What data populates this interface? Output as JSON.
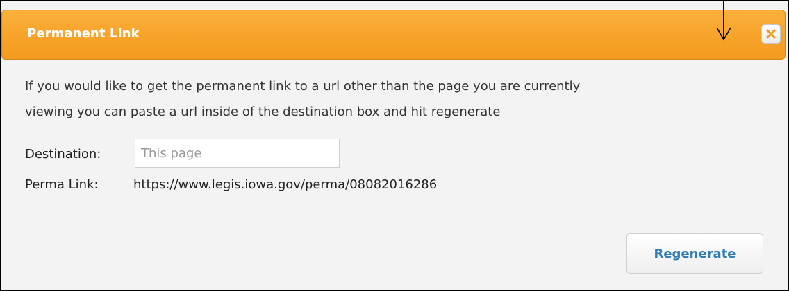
{
  "dialog": {
    "title": "Permanent Link",
    "close_icon": "close-icon",
    "description_line1": "If you would like to get the permanent link to a url other than the page you are currently",
    "description_line2": "viewing you can paste a url inside of the destination box and hit regenerate",
    "destination_label": "Destination:",
    "destination_placeholder": "This page",
    "destination_value": "",
    "perma_label": "Perma Link:",
    "perma_value": "https://www.legis.iowa.gov/perma/08082016286",
    "regenerate_label": "Regenerate"
  },
  "colors": {
    "header": "#f7a329",
    "header_border": "#d08a14",
    "close_x": "#f39b1f",
    "button_text": "#2e7bb5",
    "body_bg": "#f3f3f3"
  },
  "annotation": {
    "arrow_icon": "down-arrow-icon"
  }
}
